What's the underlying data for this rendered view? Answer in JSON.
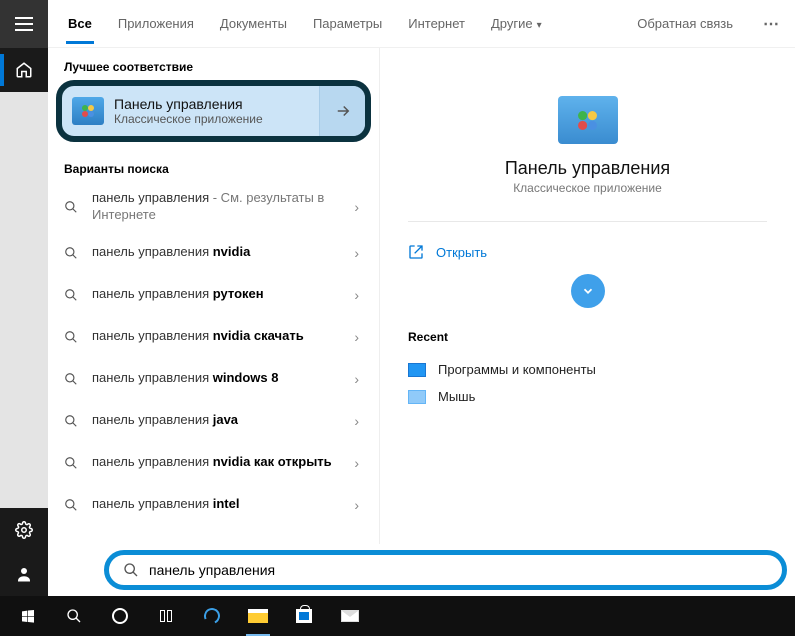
{
  "tabs": {
    "items": [
      "Все",
      "Приложения",
      "Документы",
      "Параметры",
      "Интернет",
      "Другие"
    ],
    "feedback": "Обратная связь"
  },
  "left": {
    "best_match_label": "Лучшее соответствие",
    "best_match": {
      "title": "Панель управления",
      "subtitle": "Классическое приложение"
    },
    "variants_label": "Варианты поиска",
    "results": [
      {
        "plain": "панель управления",
        "bold": "",
        "suffix": " - См. результаты в Интернете"
      },
      {
        "plain": "панель управления ",
        "bold": "nvidia",
        "suffix": ""
      },
      {
        "plain": "панель управления ",
        "bold": "рутокен",
        "suffix": ""
      },
      {
        "plain": "панель управления ",
        "bold": "nvidia скачать",
        "suffix": ""
      },
      {
        "plain": "панель управления ",
        "bold": "windows 8",
        "suffix": ""
      },
      {
        "plain": "панель управления ",
        "bold": "java",
        "suffix": ""
      },
      {
        "plain": "панель управления ",
        "bold": "nvidia как открыть",
        "suffix": ""
      },
      {
        "plain": "панель управления ",
        "bold": "intel",
        "suffix": ""
      }
    ]
  },
  "right": {
    "title": "Панель управления",
    "subtitle": "Классическое приложение",
    "open": "Открыть",
    "recent_label": "Recent",
    "recent": [
      "Программы и компоненты",
      "Мышь"
    ]
  },
  "search": {
    "value": "панель управления"
  }
}
